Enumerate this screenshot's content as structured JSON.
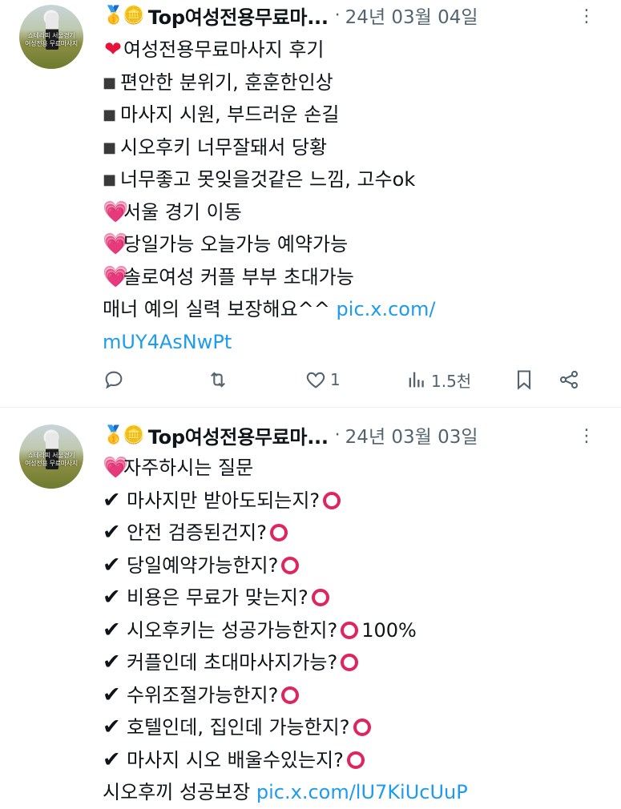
{
  "tweets": [
    {
      "medals": "🥇🪙",
      "author": "Top여성전용무료마...",
      "dot": "·",
      "date": "24년 03월 04일",
      "more": "⋮",
      "avatar_caption": "쇼테라피 서울경기\n여성전용 무료마사지",
      "lines": [
        {
          "emoji": "❤",
          "text": "여성전용무료마사지 후기"
        },
        {
          "bullet": "■",
          "text": "편안한 분위기, 훈훈한인상"
        },
        {
          "bullet": "■",
          "text": "마사지 시원, 부드러운 손길"
        },
        {
          "bullet": "■",
          "text": "시오후키 너무잘돼서 당황"
        },
        {
          "bullet": "■",
          "text": "너무좋고 못잊을것같은 느낌, 고수ok"
        },
        {
          "emoji": "💗",
          "text": "서울 경기 이동"
        },
        {
          "emoji": "💗",
          "text": "당일가능 오늘가능 예약가능"
        },
        {
          "emoji": "💗",
          "text": "솔로여성 커플 부부 초대가능"
        },
        {
          "text": "매너 예의 실력 보장해요^^ ",
          "link": "pic.x.com/"
        },
        {
          "link": "mUY4AsNwPt"
        }
      ],
      "actions": {
        "reply": "",
        "retweet": "",
        "likes": "1",
        "views": "1.5천"
      }
    },
    {
      "medals": "🥇🪙",
      "author": "Top여성전용무료마...",
      "dot": "·",
      "date": "24년 03월 03일",
      "more": "⋮",
      "avatar_caption": "쇼테라피 서울경기\n여성전용 무료마사지",
      "lines": [
        {
          "emoji": "💗",
          "text": "자주하시는 질문"
        },
        {
          "check": "✔",
          "text": "마사지만 받아도되는지?",
          "circle": true
        },
        {
          "check": "✔",
          "text": "안전 검증된건지?",
          "circle": true
        },
        {
          "check": "✔",
          "text": "당일예약가능한지?",
          "circle": true
        },
        {
          "check": "✔",
          "text": "비용은 무료가 맞는지?",
          "circle": true
        },
        {
          "check": "✔",
          "text": "시오후키는 성공가능한지?",
          "circle": true,
          "after": "100%"
        },
        {
          "check": "✔",
          "text": "커플인데 초대마사지가능?",
          "circle": true
        },
        {
          "check": "✔",
          "text": "수위조절가능한지?",
          "circle": true
        },
        {
          "check": "✔",
          "text": "호텔인데, 집인데 가능한지?",
          "circle": true
        },
        {
          "check": "✔",
          "text": "마사지 시오 배울수있는지?",
          "circle": true
        },
        {
          "text": "시오후끼 성공보장 ",
          "link": "pic.x.com/lU7KiUcUuP"
        }
      ]
    }
  ],
  "colors": {
    "link": "#1d9bf0",
    "muted": "#536471",
    "circle": "#e0245e",
    "heart_red": "#e8113a",
    "heart_pink": "#f46ec0"
  },
  "icons": [
    "reply-icon",
    "retweet-icon",
    "like-icon",
    "views-icon",
    "bookmark-icon",
    "share-icon",
    "more-icon",
    "check-icon",
    "circle-mark-icon"
  ]
}
